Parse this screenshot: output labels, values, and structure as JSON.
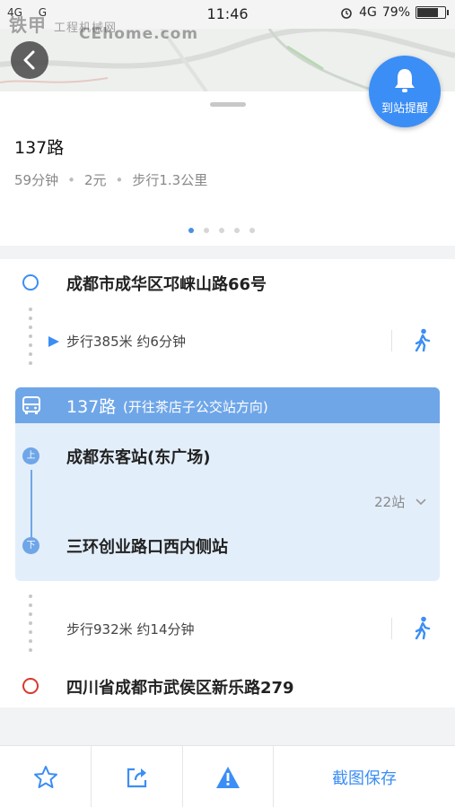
{
  "status_bar": {
    "network_left": "4G",
    "carrier_mark": "G",
    "time": "11:46",
    "network_right": "4G",
    "battery": "79%",
    "battery_level": 0.79
  },
  "watermark": {
    "brand": "铁甲",
    "site": "工程机械网",
    "domain": "CEhome.com"
  },
  "header": {
    "alert_label": "到站提醒"
  },
  "summary": {
    "route_name": "137路",
    "duration": "59分钟",
    "fare": "2元",
    "walk_total": "步行1.3公里",
    "page_count": 5,
    "active_page": 1
  },
  "route": {
    "origin": "成都市成华区邛崃山路66号",
    "walk1": "步行385米 约6分钟",
    "bus": {
      "line": "137路",
      "direction": "(开往茶店子公交站方向)",
      "board_marker": "上",
      "alight_marker": "下",
      "board_stop": "成都东客站(东广场)",
      "alight_stop": "三环创业路口西内侧站",
      "stops": "22站"
    },
    "walk2": "步行932米 约14分钟",
    "destination": "四川省成都市武侯区新乐路279"
  },
  "toolbar": {
    "save_label": "截图保存"
  },
  "colors": {
    "accent": "#3b8ef5",
    "bus_header": "#6fa6e8",
    "bus_bg": "#e3eefb",
    "origin_ring": "#3b8ef5",
    "dest_ring": "#d9382e"
  }
}
